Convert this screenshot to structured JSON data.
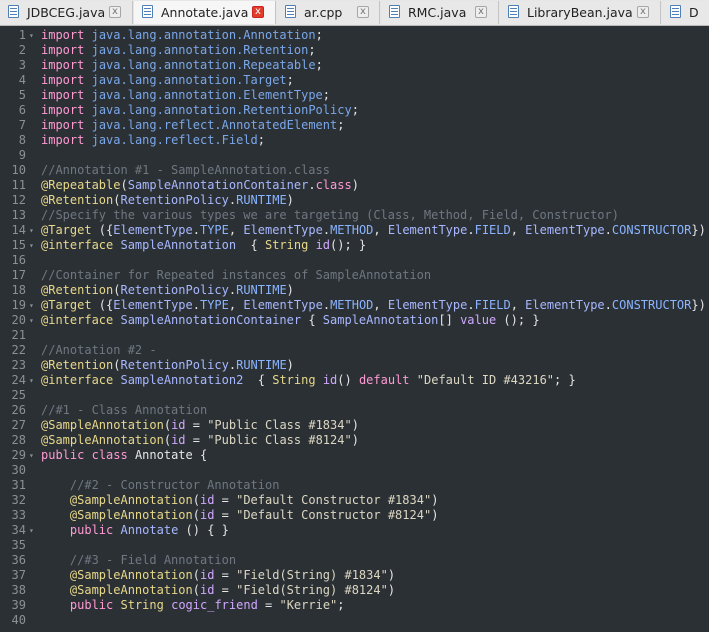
{
  "tabs": [
    {
      "label": "JDBCEG.java",
      "active": false,
      "close": "x"
    },
    {
      "label": "Annotate.java",
      "active": true,
      "close": "x"
    },
    {
      "label": "ar.cpp",
      "active": false,
      "close": "x"
    },
    {
      "label": "RMC.java",
      "active": false,
      "close": "x"
    },
    {
      "label": "LibraryBean.java",
      "active": false,
      "close": "x"
    },
    {
      "label": "D",
      "active": false,
      "close": ""
    }
  ],
  "lines": [
    {
      "n": "1",
      "fold": "▾",
      "t": [
        [
          "kw",
          "import"
        ],
        [
          "op",
          " "
        ],
        [
          "pkg",
          "java.lang.annotation.Annotation"
        ],
        [
          "op",
          ";"
        ]
      ]
    },
    {
      "n": "2",
      "fold": "",
      "t": [
        [
          "kw",
          "import"
        ],
        [
          "op",
          " "
        ],
        [
          "pkg",
          "java.lang.annotation.Retention"
        ],
        [
          "op",
          ";"
        ]
      ]
    },
    {
      "n": "3",
      "fold": "",
      "t": [
        [
          "kw",
          "import"
        ],
        [
          "op",
          " "
        ],
        [
          "pkg",
          "java.lang.annotation.Repeatable"
        ],
        [
          "op",
          ";"
        ]
      ]
    },
    {
      "n": "4",
      "fold": "",
      "t": [
        [
          "kw",
          "import"
        ],
        [
          "op",
          " "
        ],
        [
          "pkg",
          "java.lang.annotation.Target"
        ],
        [
          "op",
          ";"
        ]
      ]
    },
    {
      "n": "5",
      "fold": "",
      "t": [
        [
          "kw",
          "import"
        ],
        [
          "op",
          " "
        ],
        [
          "pkg",
          "java.lang.annotation.ElementType"
        ],
        [
          "op",
          ";"
        ]
      ]
    },
    {
      "n": "6",
      "fold": "",
      "t": [
        [
          "kw",
          "import"
        ],
        [
          "op",
          " "
        ],
        [
          "pkg",
          "java.lang.annotation.RetentionPolicy"
        ],
        [
          "op",
          ";"
        ]
      ]
    },
    {
      "n": "7",
      "fold": "",
      "t": [
        [
          "kw",
          "import"
        ],
        [
          "op",
          " "
        ],
        [
          "pkg",
          "java.lang.reflect.AnnotatedElement"
        ],
        [
          "op",
          ";"
        ]
      ]
    },
    {
      "n": "8",
      "fold": "",
      "t": [
        [
          "kw",
          "import"
        ],
        [
          "op",
          " "
        ],
        [
          "pkg",
          "java.lang.reflect.Field"
        ],
        [
          "op",
          ";"
        ]
      ]
    },
    {
      "n": "9",
      "fold": "",
      "t": []
    },
    {
      "n": "10",
      "fold": "",
      "t": [
        [
          "com",
          "//Annotation #1 - SampleAnnotation.class"
        ]
      ]
    },
    {
      "n": "11",
      "fold": "",
      "t": [
        [
          "ann",
          "@Repeatable"
        ],
        [
          "op",
          "("
        ],
        [
          "cls",
          "SampleAnnotationContainer"
        ],
        [
          "op",
          "."
        ],
        [
          "kw",
          "class"
        ],
        [
          "op",
          ")"
        ]
      ]
    },
    {
      "n": "12",
      "fold": "",
      "t": [
        [
          "ann",
          "@Retention"
        ],
        [
          "op",
          "("
        ],
        [
          "cls",
          "RetentionPolicy"
        ],
        [
          "op",
          "."
        ],
        [
          "const",
          "RUNTIME"
        ],
        [
          "op",
          ")"
        ]
      ]
    },
    {
      "n": "13",
      "fold": "",
      "t": [
        [
          "com",
          "//Specify the various types we are targeting (Class, Method, Field, Constructor)"
        ]
      ]
    },
    {
      "n": "14",
      "fold": "▾",
      "t": [
        [
          "ann",
          "@Target"
        ],
        [
          "op",
          " ({"
        ],
        [
          "cls",
          "ElementType"
        ],
        [
          "op",
          "."
        ],
        [
          "const",
          "TYPE"
        ],
        [
          "op",
          ", "
        ],
        [
          "cls",
          "ElementType"
        ],
        [
          "op",
          "."
        ],
        [
          "const",
          "METHOD"
        ],
        [
          "op",
          ", "
        ],
        [
          "cls",
          "ElementType"
        ],
        [
          "op",
          "."
        ],
        [
          "const",
          "FIELD"
        ],
        [
          "op",
          ", "
        ],
        [
          "cls",
          "ElementType"
        ],
        [
          "op",
          "."
        ],
        [
          "const",
          "CONSTRUCTOR"
        ],
        [
          "op",
          "})"
        ]
      ]
    },
    {
      "n": "15",
      "fold": "▾",
      "t": [
        [
          "ann",
          "@interface"
        ],
        [
          "op",
          " "
        ],
        [
          "cls",
          "SampleAnnotation"
        ],
        [
          "op",
          "  { "
        ],
        [
          "type",
          "String"
        ],
        [
          "op",
          " "
        ],
        [
          "attr",
          "id"
        ],
        [
          "op",
          "(); }"
        ]
      ]
    },
    {
      "n": "16",
      "fold": "",
      "t": []
    },
    {
      "n": "17",
      "fold": "",
      "t": [
        [
          "com",
          "//Container for Repeated instances of SampleAnnotation"
        ]
      ]
    },
    {
      "n": "18",
      "fold": "",
      "t": [
        [
          "ann",
          "@Retention"
        ],
        [
          "op",
          "("
        ],
        [
          "cls",
          "RetentionPolicy"
        ],
        [
          "op",
          "."
        ],
        [
          "const",
          "RUNTIME"
        ],
        [
          "op",
          ")"
        ]
      ]
    },
    {
      "n": "19",
      "fold": "▾",
      "t": [
        [
          "ann",
          "@Target"
        ],
        [
          "op",
          " ({"
        ],
        [
          "cls",
          "ElementType"
        ],
        [
          "op",
          "."
        ],
        [
          "const",
          "TYPE"
        ],
        [
          "op",
          ", "
        ],
        [
          "cls",
          "ElementType"
        ],
        [
          "op",
          "."
        ],
        [
          "const",
          "METHOD"
        ],
        [
          "op",
          ", "
        ],
        [
          "cls",
          "ElementType"
        ],
        [
          "op",
          "."
        ],
        [
          "const",
          "FIELD"
        ],
        [
          "op",
          ", "
        ],
        [
          "cls",
          "ElementType"
        ],
        [
          "op",
          "."
        ],
        [
          "const",
          "CONSTRUCTOR"
        ],
        [
          "op",
          "})"
        ]
      ]
    },
    {
      "n": "20",
      "fold": "▾",
      "t": [
        [
          "ann",
          "@interface"
        ],
        [
          "op",
          " "
        ],
        [
          "cls",
          "SampleAnnotationContainer"
        ],
        [
          "op",
          " { "
        ],
        [
          "cls",
          "SampleAnnotation"
        ],
        [
          "op",
          "[] "
        ],
        [
          "attr",
          "value"
        ],
        [
          "op",
          " (); }"
        ]
      ]
    },
    {
      "n": "21",
      "fold": "",
      "t": []
    },
    {
      "n": "22",
      "fold": "",
      "t": [
        [
          "com",
          "//Anotation #2 -"
        ]
      ]
    },
    {
      "n": "23",
      "fold": "",
      "t": [
        [
          "ann",
          "@Retention"
        ],
        [
          "op",
          "("
        ],
        [
          "cls",
          "RetentionPolicy"
        ],
        [
          "op",
          "."
        ],
        [
          "const",
          "RUNTIME"
        ],
        [
          "op",
          ")"
        ]
      ]
    },
    {
      "n": "24",
      "fold": "▾",
      "t": [
        [
          "ann",
          "@interface"
        ],
        [
          "op",
          " "
        ],
        [
          "cls",
          "SampleAnnotation2"
        ],
        [
          "op",
          "  { "
        ],
        [
          "type",
          "String"
        ],
        [
          "op",
          " "
        ],
        [
          "attr",
          "id"
        ],
        [
          "op",
          "() "
        ],
        [
          "kw",
          "default"
        ],
        [
          "op",
          " "
        ],
        [
          "str",
          "\"Default ID #43216\""
        ],
        [
          "op",
          "; }"
        ]
      ]
    },
    {
      "n": "25",
      "fold": "",
      "t": []
    },
    {
      "n": "26",
      "fold": "",
      "t": [
        [
          "com",
          "//#1 - Class Annotation"
        ]
      ]
    },
    {
      "n": "27",
      "fold": "",
      "t": [
        [
          "ann",
          "@SampleAnnotation"
        ],
        [
          "op",
          "("
        ],
        [
          "attr",
          "id"
        ],
        [
          "op",
          " = "
        ],
        [
          "str",
          "\"Public Class #1834\""
        ],
        [
          "op",
          ")"
        ]
      ]
    },
    {
      "n": "28",
      "fold": "",
      "t": [
        [
          "ann",
          "@SampleAnnotation"
        ],
        [
          "op",
          "("
        ],
        [
          "attr",
          "id"
        ],
        [
          "op",
          " = "
        ],
        [
          "str",
          "\"Public Class #8124\""
        ],
        [
          "op",
          ")"
        ]
      ]
    },
    {
      "n": "29",
      "fold": "▾",
      "t": [
        [
          "kw",
          "public"
        ],
        [
          "op",
          " "
        ],
        [
          "kw",
          "class"
        ],
        [
          "op",
          " Annotate {"
        ]
      ]
    },
    {
      "n": "30",
      "fold": "",
      "t": []
    },
    {
      "n": "31",
      "fold": "",
      "t": [
        [
          "op",
          "    "
        ],
        [
          "com",
          "//#2 - Constructor Annotation"
        ]
      ]
    },
    {
      "n": "32",
      "fold": "",
      "t": [
        [
          "op",
          "    "
        ],
        [
          "ann",
          "@SampleAnnotation"
        ],
        [
          "op",
          "("
        ],
        [
          "attr",
          "id"
        ],
        [
          "op",
          " = "
        ],
        [
          "str",
          "\"Default Constructor #1834\""
        ],
        [
          "op",
          ")"
        ]
      ]
    },
    {
      "n": "33",
      "fold": "",
      "t": [
        [
          "op",
          "    "
        ],
        [
          "ann",
          "@SampleAnnotation"
        ],
        [
          "op",
          "("
        ],
        [
          "attr",
          "id"
        ],
        [
          "op",
          " = "
        ],
        [
          "str",
          "\"Default Constructor #8124\""
        ],
        [
          "op",
          ")"
        ]
      ]
    },
    {
      "n": "34",
      "fold": "▾",
      "t": [
        [
          "op",
          "    "
        ],
        [
          "kw",
          "public"
        ],
        [
          "op",
          " "
        ],
        [
          "cls",
          "Annotate"
        ],
        [
          "op",
          " () { }"
        ]
      ]
    },
    {
      "n": "35",
      "fold": "",
      "t": []
    },
    {
      "n": "36",
      "fold": "",
      "t": [
        [
          "op",
          "    "
        ],
        [
          "com",
          "//#3 - Field Annotation"
        ]
      ]
    },
    {
      "n": "37",
      "fold": "",
      "t": [
        [
          "op",
          "    "
        ],
        [
          "ann",
          "@SampleAnnotation"
        ],
        [
          "op",
          "("
        ],
        [
          "attr",
          "id"
        ],
        [
          "op",
          " = "
        ],
        [
          "str",
          "\"Field(String) #1834\""
        ],
        [
          "op",
          ")"
        ]
      ]
    },
    {
      "n": "38",
      "fold": "",
      "t": [
        [
          "op",
          "    "
        ],
        [
          "ann",
          "@SampleAnnotation"
        ],
        [
          "op",
          "("
        ],
        [
          "attr",
          "id"
        ],
        [
          "op",
          " = "
        ],
        [
          "str",
          "\"Field(String) #8124\""
        ],
        [
          "op",
          ")"
        ]
      ]
    },
    {
      "n": "39",
      "fold": "",
      "t": [
        [
          "op",
          "    "
        ],
        [
          "kw",
          "public"
        ],
        [
          "op",
          " "
        ],
        [
          "type",
          "String"
        ],
        [
          "op",
          " "
        ],
        [
          "attr",
          "cogic_friend"
        ],
        [
          "op",
          " = "
        ],
        [
          "str",
          "\"Kerrie\""
        ],
        [
          "op",
          ";"
        ]
      ]
    },
    {
      "n": "40",
      "fold": "",
      "t": []
    }
  ]
}
